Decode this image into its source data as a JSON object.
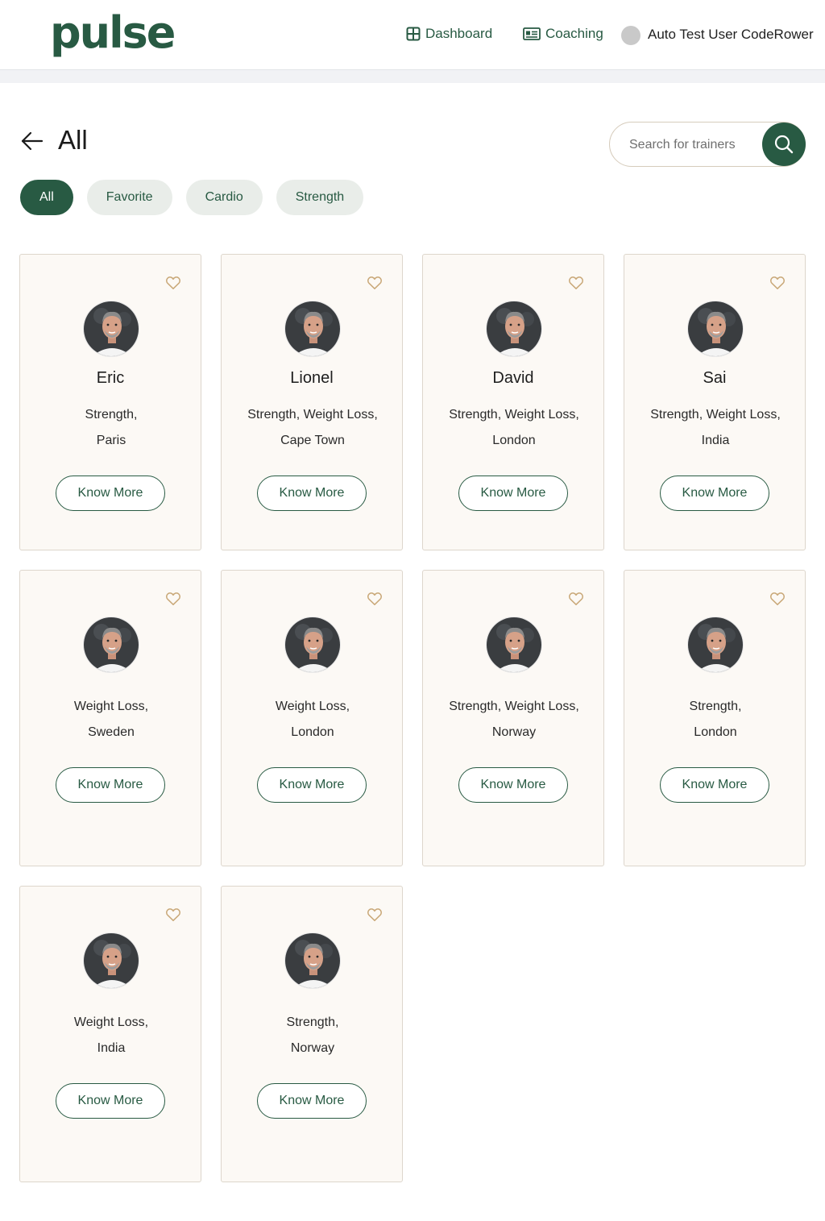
{
  "header": {
    "logo": "pulse",
    "nav": [
      {
        "label": "Dashboard",
        "icon": "dashboard-grid-icon"
      },
      {
        "label": "Coaching",
        "icon": "id-card-icon"
      }
    ],
    "user_name": "Auto Test User CodeRower"
  },
  "page": {
    "title": "All",
    "search_placeholder": "Search for trainers"
  },
  "filters": [
    {
      "label": "All",
      "active": true
    },
    {
      "label": "Favorite",
      "active": false
    },
    {
      "label": "Cardio",
      "active": false
    },
    {
      "label": "Strength",
      "active": false
    }
  ],
  "trainers": [
    {
      "name": "Eric",
      "tags": "Strength,",
      "location": "Paris",
      "button": "Know More"
    },
    {
      "name": "Lionel",
      "tags": "Strength, Weight Loss,",
      "location": "Cape Town",
      "button": "Know More"
    },
    {
      "name": "David",
      "tags": "Strength, Weight Loss,",
      "location": "London",
      "button": "Know More"
    },
    {
      "name": "Sai",
      "tags": "Strength, Weight Loss,",
      "location": "India",
      "button": "Know More"
    },
    {
      "name": "",
      "tags": "Weight Loss,",
      "location": "Sweden",
      "button": "Know More"
    },
    {
      "name": "",
      "tags": "Weight Loss,",
      "location": "London",
      "button": "Know More"
    },
    {
      "name": "",
      "tags": "Strength, Weight Loss,",
      "location": "Norway",
      "button": "Know More"
    },
    {
      "name": "",
      "tags": "Strength,",
      "location": "London",
      "button": "Know More"
    },
    {
      "name": "",
      "tags": "Weight Loss,",
      "location": "India",
      "button": "Know More"
    },
    {
      "name": "",
      "tags": "Strength,",
      "location": "Norway",
      "button": "Know More"
    }
  ],
  "colors": {
    "brand": "#285a43",
    "card_bg": "#fcf9f5",
    "heart": "#c9a878"
  }
}
